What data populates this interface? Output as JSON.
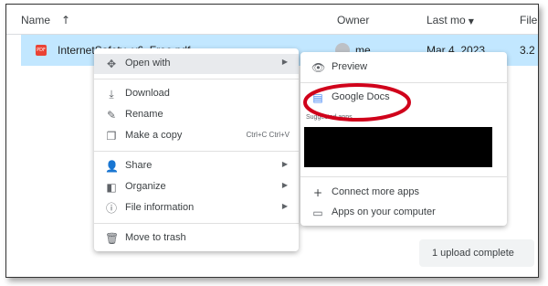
{
  "header": {
    "name": "Name",
    "sort_icon": "arrow-up",
    "owner": "Owner",
    "last_modified": "Last mo",
    "file_size": "File"
  },
  "file": {
    "name": "InternetSafety_v6_Free.pdf",
    "owner": "me",
    "date": "Mar 4, 2023",
    "size": "3.2"
  },
  "context_menu": {
    "items": [
      {
        "icon": "move",
        "label": "Open with",
        "submenu": true
      },
      {
        "icon": "download",
        "label": "Download"
      },
      {
        "icon": "edit",
        "label": "Rename"
      },
      {
        "icon": "copy",
        "label": "Make a copy",
        "shortcut": "Ctrl+C Ctrl+V"
      },
      {
        "icon": "person-add",
        "label": "Share",
        "submenu": true
      },
      {
        "icon": "folder",
        "label": "Organize",
        "submenu": true
      },
      {
        "icon": "info",
        "label": "File information",
        "submenu": true
      },
      {
        "icon": "trash",
        "label": "Move to trash"
      }
    ]
  },
  "submenu": {
    "preview": "Preview",
    "google_docs": "Google Docs",
    "suggested_label": "Suggested apps",
    "connect": "Connect more apps",
    "computer": "Apps on your computer"
  },
  "toast": "1 upload complete",
  "colors": {
    "selected_row": "#c2e7ff",
    "highlight_circle": "#d0021b",
    "docs_blue": "#4285f4"
  }
}
